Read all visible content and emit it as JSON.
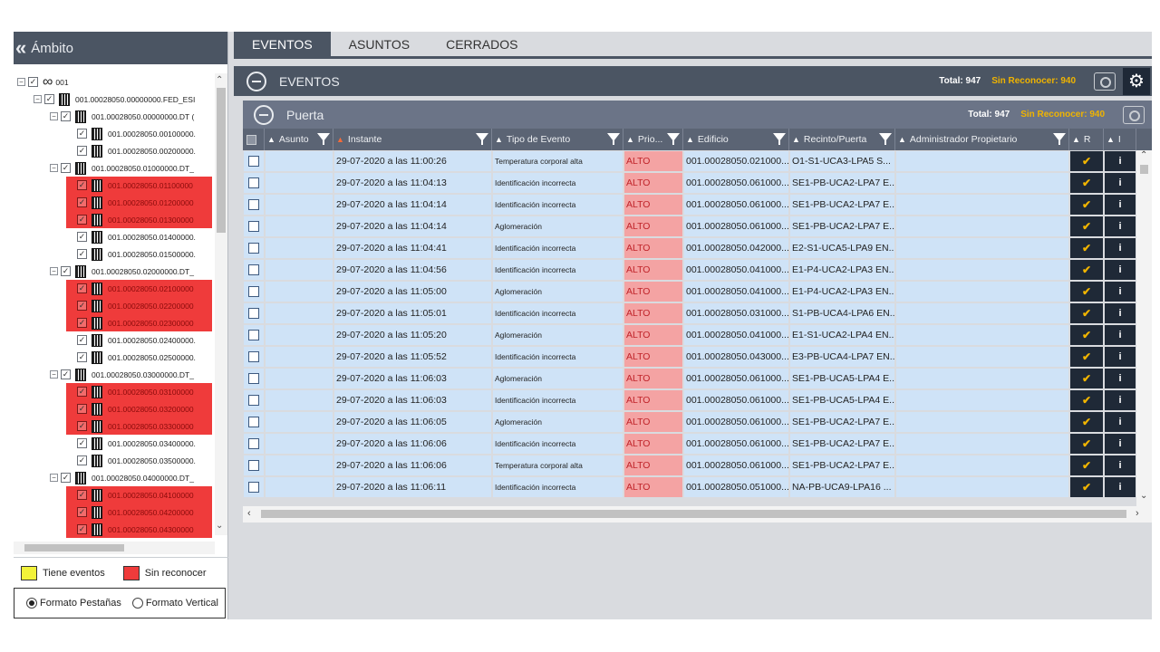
{
  "left": {
    "title": "Ámbito",
    "tree": [
      {
        "label": "001",
        "depth": 0,
        "red": false
      },
      {
        "label": "001.00028050.00000000.FED_ESI",
        "depth": 1,
        "red": false
      },
      {
        "label": "001.00028050.00000000.DT (",
        "depth": 2,
        "red": false
      },
      {
        "label": "001.00028050.00100000.",
        "depth": 3,
        "red": false
      },
      {
        "label": "001.00028050.00200000.",
        "depth": 3,
        "red": false
      },
      {
        "label": "001.00028050.01000000.DT_",
        "depth": 2,
        "red": false
      },
      {
        "label": "001.00028050.01100000",
        "depth": 3,
        "red": true
      },
      {
        "label": "001.00028050.01200000",
        "depth": 3,
        "red": true
      },
      {
        "label": "001.00028050.01300000",
        "depth": 3,
        "red": true
      },
      {
        "label": "001.00028050.01400000.",
        "depth": 3,
        "red": false
      },
      {
        "label": "001.00028050.01500000.",
        "depth": 3,
        "red": false
      },
      {
        "label": "001.00028050.02000000.DT_",
        "depth": 2,
        "red": false
      },
      {
        "label": "001.00028050.02100000",
        "depth": 3,
        "red": true
      },
      {
        "label": "001.00028050.02200000",
        "depth": 3,
        "red": true
      },
      {
        "label": "001.00028050.02300000",
        "depth": 3,
        "red": true
      },
      {
        "label": "001.00028050.02400000.",
        "depth": 3,
        "red": false
      },
      {
        "label": "001.00028050.02500000.",
        "depth": 3,
        "red": false
      },
      {
        "label": "001.00028050.03000000.DT_",
        "depth": 2,
        "red": false
      },
      {
        "label": "001.00028050.03100000",
        "depth": 3,
        "red": true
      },
      {
        "label": "001.00028050.03200000",
        "depth": 3,
        "red": true
      },
      {
        "label": "001.00028050.03300000",
        "depth": 3,
        "red": true
      },
      {
        "label": "001.00028050.03400000.",
        "depth": 3,
        "red": false
      },
      {
        "label": "001.00028050.03500000.",
        "depth": 3,
        "red": false
      },
      {
        "label": "001.00028050.04000000.DT_",
        "depth": 2,
        "red": false
      },
      {
        "label": "001.00028050.04100000",
        "depth": 3,
        "red": true
      },
      {
        "label": "001.00028050.04200000",
        "depth": 3,
        "red": true
      },
      {
        "label": "001.00028050.04300000",
        "depth": 3,
        "red": true
      }
    ],
    "legend": {
      "yellow_label": "Tiene eventos",
      "yellow_color": "#f2f23a",
      "red_label": "Sin reconocer",
      "red_color": "#ef3b3b"
    },
    "formato": {
      "tabs_label": "Formato Pestañas",
      "vertical_label": "Formato Vertical",
      "selected": "tabs"
    }
  },
  "tabs": [
    {
      "label": "EVENTOS",
      "active": true
    },
    {
      "label": "ASUNTOS",
      "active": false
    },
    {
      "label": "CERRADOS",
      "active": false
    }
  ],
  "eventos_bar": {
    "title": "EVENTOS",
    "total": "Total: 947",
    "sin_reconocer": "Sin Reconocer: 940"
  },
  "puerta_bar": {
    "title": "Puerta",
    "total": "Total: 947",
    "sin_reconocer": "Sin Reconocer: 940"
  },
  "columns": [
    "Asunto",
    "Instante",
    "Tipo de Evento",
    "Prio...",
    "Edificio",
    "Recinto/Puerta",
    "Administrador Propietario",
    "R",
    "I"
  ],
  "rows": [
    {
      "asunto": "",
      "instante": "29-07-2020 a las 11:00:26",
      "tipo": "Temperatura corporal alta",
      "prio": "ALTO",
      "edificio": "001.00028050.021000...",
      "recinto": "O1-S1-UCA3-LPA5 S...",
      "admin": ""
    },
    {
      "asunto": "",
      "instante": "29-07-2020 a las 11:04:13",
      "tipo": "Identificación incorrecta",
      "prio": "ALTO",
      "edificio": "001.00028050.061000...",
      "recinto": "SE1-PB-UCA2-LPA7 E...",
      "admin": ""
    },
    {
      "asunto": "",
      "instante": "29-07-2020 a las 11:04:14",
      "tipo": "Identificación incorrecta",
      "prio": "ALTO",
      "edificio": "001.00028050.061000...",
      "recinto": "SE1-PB-UCA2-LPA7 E...",
      "admin": ""
    },
    {
      "asunto": "",
      "instante": "29-07-2020 a las 11:04:14",
      "tipo": "Aglomeración",
      "prio": "ALTO",
      "edificio": "001.00028050.061000...",
      "recinto": "SE1-PB-UCA2-LPA7 E...",
      "admin": ""
    },
    {
      "asunto": "",
      "instante": "29-07-2020 a las 11:04:41",
      "tipo": "Identificación incorrecta",
      "prio": "ALTO",
      "edificio": "001.00028050.042000...",
      "recinto": "E2-S1-UCA5-LPA9 EN...",
      "admin": ""
    },
    {
      "asunto": "",
      "instante": "29-07-2020 a las 11:04:56",
      "tipo": "Identificación incorrecta",
      "prio": "ALTO",
      "edificio": "001.00028050.041000...",
      "recinto": "E1-P4-UCA2-LPA3 EN...",
      "admin": ""
    },
    {
      "asunto": "",
      "instante": "29-07-2020 a las 11:05:00",
      "tipo": "Aglomeración",
      "prio": "ALTO",
      "edificio": "001.00028050.041000...",
      "recinto": "E1-P4-UCA2-LPA3 EN...",
      "admin": ""
    },
    {
      "asunto": "",
      "instante": "29-07-2020 a las 11:05:01",
      "tipo": "Identificación incorrecta",
      "prio": "ALTO",
      "edificio": "001.00028050.031000...",
      "recinto": "S1-PB-UCA4-LPA6 EN...",
      "admin": ""
    },
    {
      "asunto": "",
      "instante": "29-07-2020 a las 11:05:20",
      "tipo": "Aglomeración",
      "prio": "ALTO",
      "edificio": "001.00028050.041000...",
      "recinto": "E1-S1-UCA2-LPA4 EN...",
      "admin": ""
    },
    {
      "asunto": "",
      "instante": "29-07-2020 a las 11:05:52",
      "tipo": "Identificación incorrecta",
      "prio": "ALTO",
      "edificio": "001.00028050.043000...",
      "recinto": "E3-PB-UCA4-LPA7 EN...",
      "admin": ""
    },
    {
      "asunto": "",
      "instante": "29-07-2020 a las 11:06:03",
      "tipo": "Aglomeración",
      "prio": "ALTO",
      "edificio": "001.00028050.061000...",
      "recinto": "SE1-PB-UCA5-LPA4 E...",
      "admin": ""
    },
    {
      "asunto": "",
      "instante": "29-07-2020 a las 11:06:03",
      "tipo": "Identificación incorrecta",
      "prio": "ALTO",
      "edificio": "001.00028050.061000...",
      "recinto": "SE1-PB-UCA5-LPA4 E...",
      "admin": ""
    },
    {
      "asunto": "",
      "instante": "29-07-2020 a las 11:06:05",
      "tipo": "Aglomeración",
      "prio": "ALTO",
      "edificio": "001.00028050.061000...",
      "recinto": "SE1-PB-UCA2-LPA7 E...",
      "admin": ""
    },
    {
      "asunto": "",
      "instante": "29-07-2020 a las 11:06:06",
      "tipo": "Identificación incorrecta",
      "prio": "ALTO",
      "edificio": "001.00028050.061000...",
      "recinto": "SE1-PB-UCA2-LPA7 E...",
      "admin": ""
    },
    {
      "asunto": "",
      "instante": "29-07-2020 a las 11:06:06",
      "tipo": "Temperatura corporal alta",
      "prio": "ALTO",
      "edificio": "001.00028050.061000...",
      "recinto": "SE1-PB-UCA2-LPA7 E...",
      "admin": ""
    },
    {
      "asunto": "",
      "instante": "29-07-2020 a las 11:06:11",
      "tipo": "Identificación incorrecta",
      "prio": "ALTO",
      "edificio": "001.00028050.051000...",
      "recinto": "NA-PB-UCA9-LPA16 ...",
      "admin": ""
    }
  ],
  "icons": {
    "collapse": "double-chevron-left-icon",
    "settings": "gear-icon",
    "acknowledge": "check-icon",
    "info": "info-icon",
    "filter": "filter-icon",
    "sort": "sort-icon"
  },
  "colors": {
    "header_dark": "#4b5563",
    "row_bg": "#cfe3f7",
    "alto_bg": "#f4a3a3",
    "alto_text": "#c0242a",
    "warning": "#f0b400"
  }
}
